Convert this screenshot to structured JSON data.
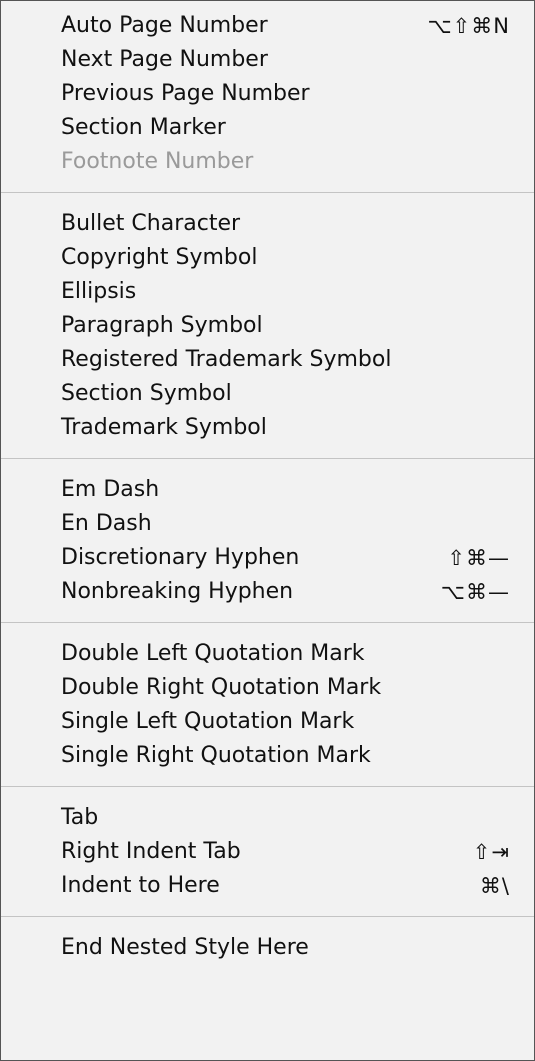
{
  "menu": {
    "groups": [
      {
        "items": [
          {
            "label": "Auto Page Number",
            "shortcut": "⌥⇧⌘N",
            "enabled": true
          },
          {
            "label": "Next Page Number",
            "shortcut": "",
            "enabled": true
          },
          {
            "label": "Previous Page Number",
            "shortcut": "",
            "enabled": true
          },
          {
            "label": "Section Marker",
            "shortcut": "",
            "enabled": true
          },
          {
            "label": "Footnote Number",
            "shortcut": "",
            "enabled": false
          }
        ]
      },
      {
        "items": [
          {
            "label": "Bullet Character",
            "shortcut": "",
            "enabled": true
          },
          {
            "label": "Copyright Symbol",
            "shortcut": "",
            "enabled": true
          },
          {
            "label": "Ellipsis",
            "shortcut": "",
            "enabled": true
          },
          {
            "label": "Paragraph Symbol",
            "shortcut": "",
            "enabled": true
          },
          {
            "label": "Registered Trademark Symbol",
            "shortcut": "",
            "enabled": true
          },
          {
            "label": "Section Symbol",
            "shortcut": "",
            "enabled": true
          },
          {
            "label": "Trademark Symbol",
            "shortcut": "",
            "enabled": true
          }
        ]
      },
      {
        "items": [
          {
            "label": "Em Dash",
            "shortcut": "",
            "enabled": true
          },
          {
            "label": "En Dash",
            "shortcut": "",
            "enabled": true
          },
          {
            "label": "Discretionary Hyphen",
            "shortcut": "⇧⌘—",
            "enabled": true
          },
          {
            "label": "Nonbreaking Hyphen",
            "shortcut": "⌥⌘—",
            "enabled": true
          }
        ]
      },
      {
        "items": [
          {
            "label": "Double Left Quotation Mark",
            "shortcut": "",
            "enabled": true
          },
          {
            "label": "Double Right Quotation Mark",
            "shortcut": "",
            "enabled": true
          },
          {
            "label": "Single Left Quotation Mark",
            "shortcut": "",
            "enabled": true
          },
          {
            "label": "Single Right Quotation Mark",
            "shortcut": "",
            "enabled": true
          }
        ]
      },
      {
        "items": [
          {
            "label": "Tab",
            "shortcut": "",
            "enabled": true
          },
          {
            "label": "Right Indent Tab",
            "shortcut": "⇧⇥",
            "enabled": true
          },
          {
            "label": "Indent to Here",
            "shortcut": "⌘\\",
            "enabled": true
          }
        ]
      },
      {
        "items": [
          {
            "label": "End Nested Style Here",
            "shortcut": "",
            "enabled": true
          }
        ]
      }
    ]
  }
}
